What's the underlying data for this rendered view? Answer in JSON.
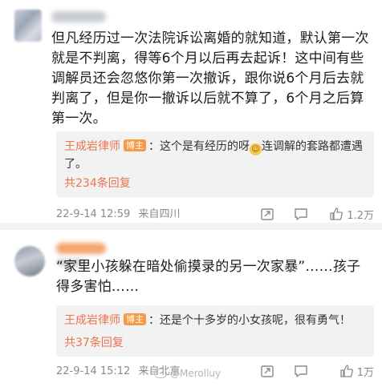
{
  "comments": [
    {
      "text": "但凡经历过一次法院诉讼离婚的就知道，默认第一次就是不判离，得等6个月以后再去起诉！这中间有些调解员还会忽悠你第一次撤诉，跟你说6个月后去就判离了，但是你一撤诉以后就不算了，6个月之后算第一次。",
      "reply": {
        "author": "王成岩律师",
        "badge": "博主",
        "text_before": "：这个是有经历的呀",
        "emoji": "crying-laughing-emoji",
        "text_after": "连调解的套路都遭遇了。",
        "count": "共234条回复"
      },
      "date": "22-9-14 12:59",
      "location": "来自四川",
      "likes": "1.2万"
    },
    {
      "text": "“家里小孩躲在暗处偷摸录的另一次家暴”……孩子得多害怕……",
      "reply": {
        "author": "王成岩律师",
        "badge": "博主",
        "text": "：还是个十多岁的小女孩呢，很有勇气！",
        "count": "共37条回复"
      },
      "date": "22-9-14 15:12",
      "location": "来自北京",
      "likes": "1万"
    }
  ],
  "watermark": "@Merolluy",
  "icons": {
    "share": "share-icon",
    "comment": "comment-icon",
    "like": "thumbs-up-icon"
  },
  "colors": {
    "accent": "#eb7350",
    "badge": "#f59a46",
    "meta": "#8a8a8a"
  }
}
